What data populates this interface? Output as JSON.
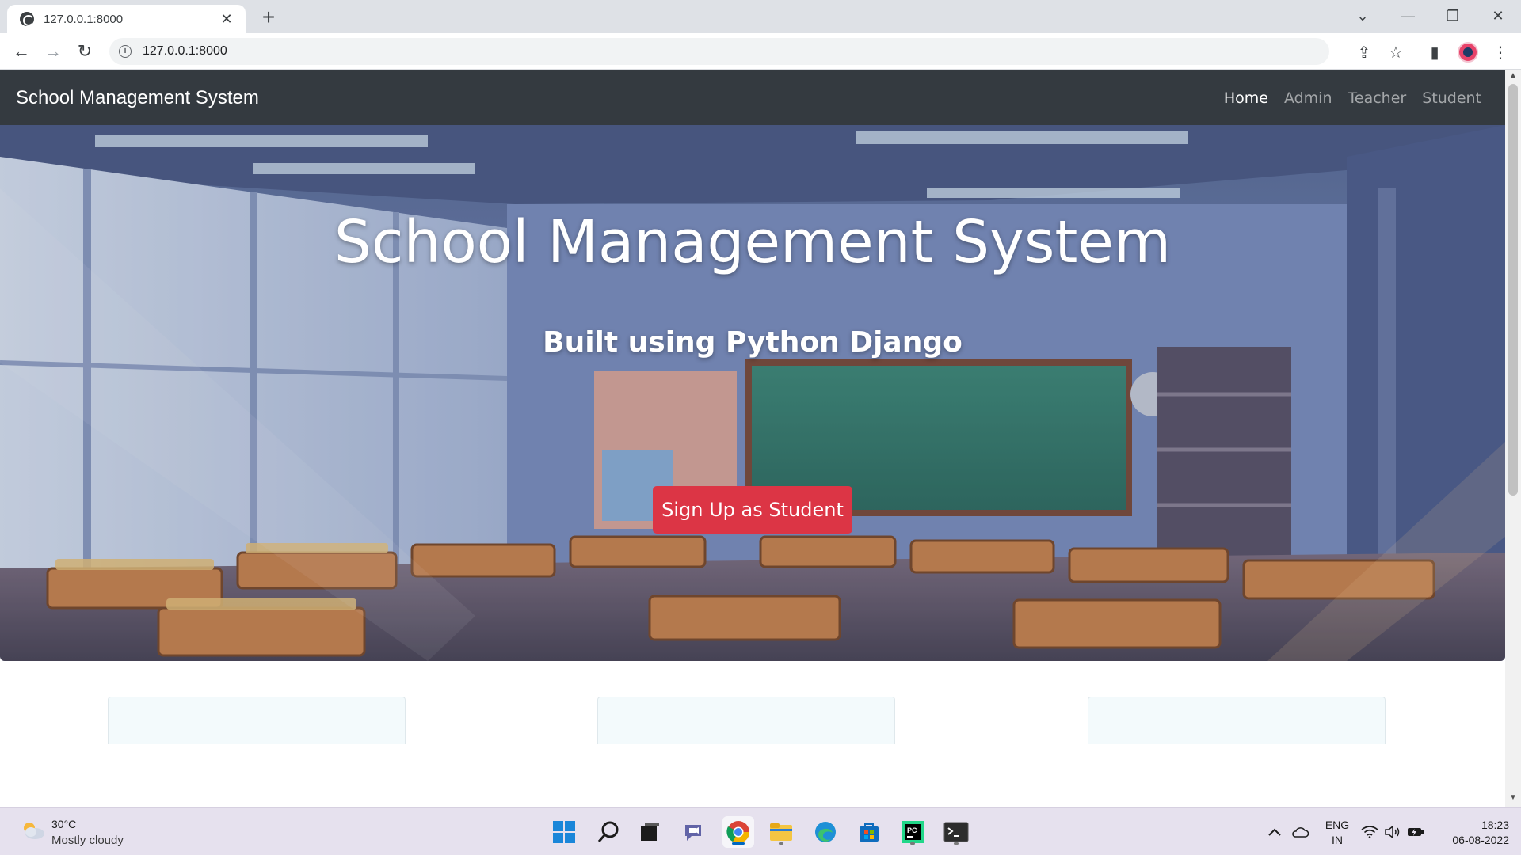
{
  "browser": {
    "tab_title": "127.0.0.1:8000",
    "url": "127.0.0.1:8000"
  },
  "page": {
    "brand": "School Management System",
    "nav_links": [
      "Home",
      "Admin",
      "Teacher",
      "Student"
    ],
    "active_nav": "Home",
    "hero_title": "School Management System",
    "hero_subtitle": "Built using Python Django",
    "signup_button": "Sign Up as Student",
    "colors": {
      "navbar": "#343a40",
      "button": "#dc3545",
      "card": "#f3fafc"
    }
  },
  "taskbar": {
    "weather_temp": "30°C",
    "weather_desc": "Mostly cloudy",
    "lang_line1": "ENG",
    "lang_line2": "IN",
    "time": "18:23",
    "date": "06-08-2022",
    "apps": [
      "start-icon",
      "search-icon",
      "task-view-icon",
      "chat-icon",
      "chrome-icon",
      "file-explorer-icon",
      "edge-icon",
      "store-icon",
      "pycharm-icon",
      "terminal-icon"
    ]
  }
}
